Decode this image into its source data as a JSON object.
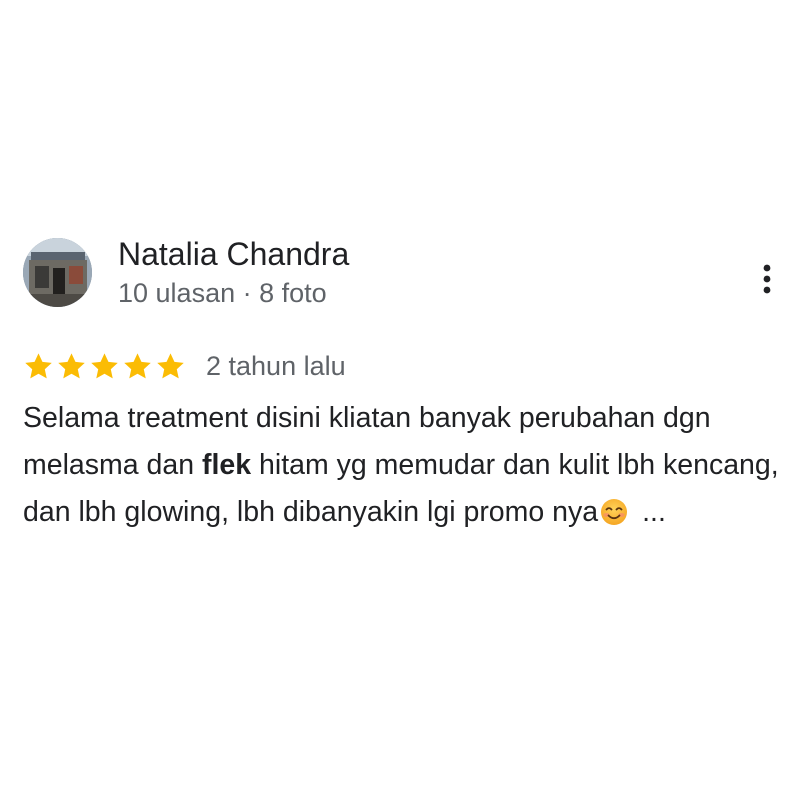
{
  "review": {
    "author": {
      "name": "Natalia Chandra",
      "meta": "10 ulasan · 8 foto",
      "avatar_icon": "profile-photo"
    },
    "rating": 5,
    "max_rating": 5,
    "star_color": "#fbbc04",
    "date": "2 tahun lalu",
    "text": {
      "part1": "Selama treatment disini kliatan banyak perubahan dgn melasma dan ",
      "highlight": "flek",
      "part2": " hitam yg memudar dan kulit lbh kencang, dan lbh glowing, lbh dibanyakin lgi promo nya",
      "emoji": "smiling-face-icon",
      "more": "..."
    },
    "more_menu_icon": "more-vertical-icon"
  }
}
